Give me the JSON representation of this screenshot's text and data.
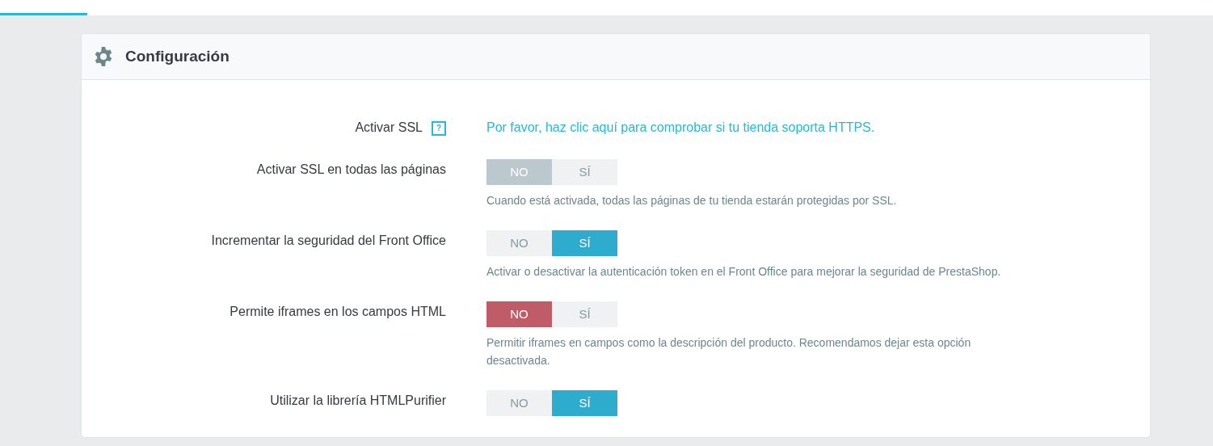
{
  "panel": {
    "title": "Configuración"
  },
  "fields": [
    {
      "kind": "link",
      "label": "Activar SSL",
      "help_icon": "?",
      "link": "Por favor, haz clic aquí para comprobar si tu tienda soporta HTTPS."
    },
    {
      "kind": "switch",
      "label": "Activar SSL en todas las páginas",
      "danger": false,
      "options": [
        {
          "label": "NO",
          "selected": true
        },
        {
          "label": "SÍ",
          "selected": false
        }
      ],
      "help": "Cuando está activada, todas las páginas de tu tienda estarán protegidas por SSL."
    },
    {
      "kind": "switch",
      "label": "Incrementar la seguridad del Front Office",
      "danger": false,
      "options": [
        {
          "label": "NO",
          "selected": false
        },
        {
          "label": "SÍ",
          "selected": true
        }
      ],
      "help": "Activar o desactivar la autenticación token en el Front Office para mejorar la seguridad de PrestaShop."
    },
    {
      "kind": "switch",
      "label": "Permite iframes en los campos HTML",
      "danger": true,
      "options": [
        {
          "label": "NO",
          "selected": true
        },
        {
          "label": "SÍ",
          "selected": false
        }
      ],
      "help": "Permitir iframes en campos como la descripción del producto. Recomendamos dejar esta opción desactivada."
    },
    {
      "kind": "switch",
      "label": "Utilizar la librería HTMLPurifier",
      "danger": false,
      "options": [
        {
          "label": "NO",
          "selected": false
        },
        {
          "label": "SÍ",
          "selected": true
        }
      ]
    }
  ]
}
